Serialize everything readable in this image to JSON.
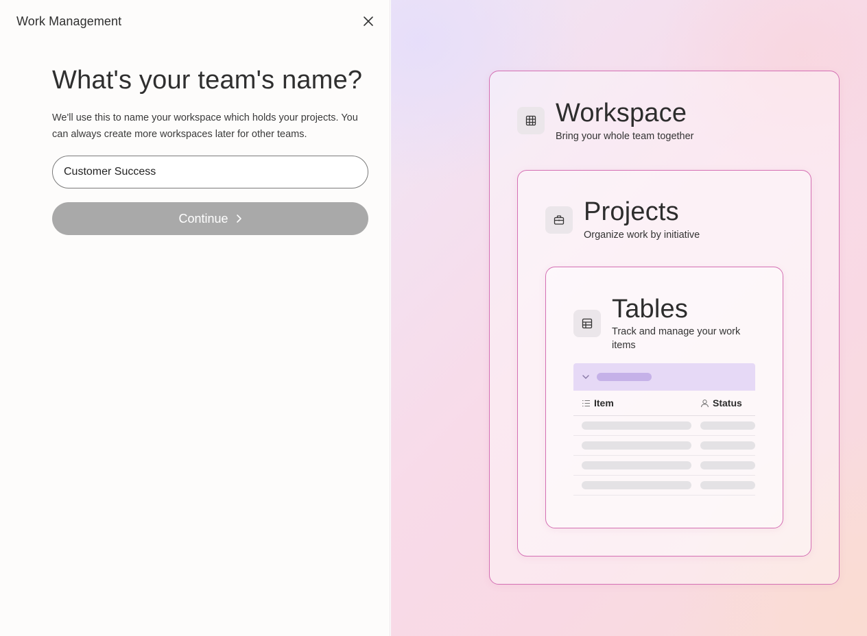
{
  "app": {
    "title": "Work Management"
  },
  "form": {
    "heading": "What's your team's name?",
    "description": "We'll use this to name your workspace which holds your projects. You can always create more workspaces later for other teams.",
    "team_name_value": "Customer Success",
    "continue_label": "Continue"
  },
  "preview": {
    "workspace": {
      "title": "Workspace",
      "subtitle": "Bring your whole team together",
      "icon": "grid-icon"
    },
    "projects": {
      "title": "Projects",
      "subtitle": "Organize work by initiative",
      "icon": "briefcase-icon"
    },
    "tables": {
      "title": "Tables",
      "subtitle": "Track and manage your work items",
      "icon": "table-icon",
      "columns": {
        "item": "Item",
        "status": "Status"
      },
      "placeholder_rows": 4
    }
  },
  "colors": {
    "accent_border": "#d46fb3",
    "button_disabled": "#a9a9a9",
    "group_header": "#e6d9f6"
  }
}
